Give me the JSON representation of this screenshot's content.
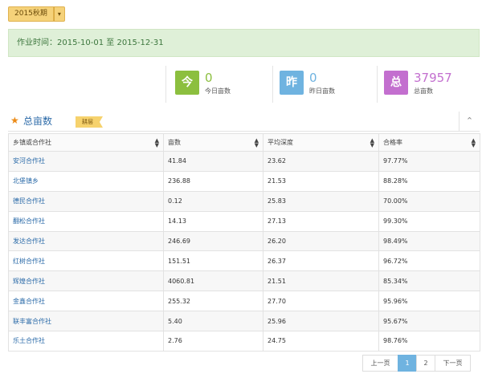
{
  "season": {
    "label": "2015秋期"
  },
  "notice": {
    "text": "作业时间：2015-10-01 至 2015-12-31"
  },
  "stats": [
    {
      "badge": "今",
      "value": "0",
      "caption": "今日亩数",
      "color": "#8cbf3f"
    },
    {
      "badge": "昨",
      "value": "0",
      "caption": "昨日亩数",
      "color": "#6fb3e0"
    },
    {
      "badge": "总",
      "value": "37957",
      "caption": "总亩数",
      "color": "#c36fcf"
    }
  ],
  "panel": {
    "title": "总亩数",
    "tag": "耕层"
  },
  "table": {
    "columns": [
      "乡镇或合作社",
      "亩数",
      "平均深度",
      "合格率"
    ],
    "rows": [
      [
        "安河合作社",
        "41.84",
        "23.62",
        "97.77%"
      ],
      [
        "北堡镇乡",
        "236.88",
        "21.53",
        "88.28%"
      ],
      [
        "德民合作社",
        "0.12",
        "25.83",
        "70.00%"
      ],
      [
        "翻松合作社",
        "14.13",
        "27.13",
        "99.30%"
      ],
      [
        "发达合作社",
        "246.69",
        "26.20",
        "98.49%"
      ],
      [
        "红树合作社",
        "151.51",
        "26.37",
        "96.72%"
      ],
      [
        "辉煌合作社",
        "4060.81",
        "21.51",
        "85.34%"
      ],
      [
        "金鑫合作社",
        "255.32",
        "27.70",
        "95.96%"
      ],
      [
        "联丰富合作社",
        "5.40",
        "25.96",
        "95.67%"
      ],
      [
        "乐土合作社",
        "2.76",
        "24.75",
        "98.76%"
      ]
    ]
  },
  "pager": {
    "prev": "上一页",
    "pages": [
      "1",
      "2"
    ],
    "next": "下一页",
    "current": "1"
  }
}
